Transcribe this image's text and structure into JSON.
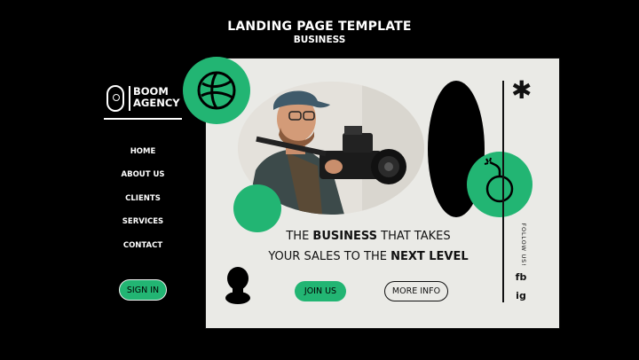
{
  "header": {
    "title": "LANDING PAGE TEMPLATE",
    "subtitle": "BUSINESS"
  },
  "brand": {
    "line1": "BOOM",
    "line2": "AGENCY",
    "logo_icon": "bulb-logo-icon"
  },
  "nav": {
    "items": [
      "HOME",
      "ABOUT US",
      "CLIENTS",
      "SERVICES",
      "CONTACT"
    ],
    "signin_label": "SIGN IN"
  },
  "hero": {
    "headline_line1_pre": "THE ",
    "headline_line1_bold": "BUSINESS",
    "headline_line1_post": " THAT TAKES",
    "headline_line2_pre": "YOUR SALES TO THE ",
    "headline_line2_bold": "NEXT LEVEL",
    "join_label": "JOIN US",
    "more_label": "MORE INFO",
    "photo": "photographer-with-camera"
  },
  "social": {
    "follow_label": "FOLLOW US!",
    "fb": "fb",
    "ig": "ig"
  },
  "colors": {
    "accent_green": "#22b573",
    "card_bg": "#eaeae6",
    "page_bg": "#000000"
  },
  "icons": [
    "globe-icon",
    "bomb-icon",
    "asterisk-icon",
    "pawn-icon"
  ]
}
